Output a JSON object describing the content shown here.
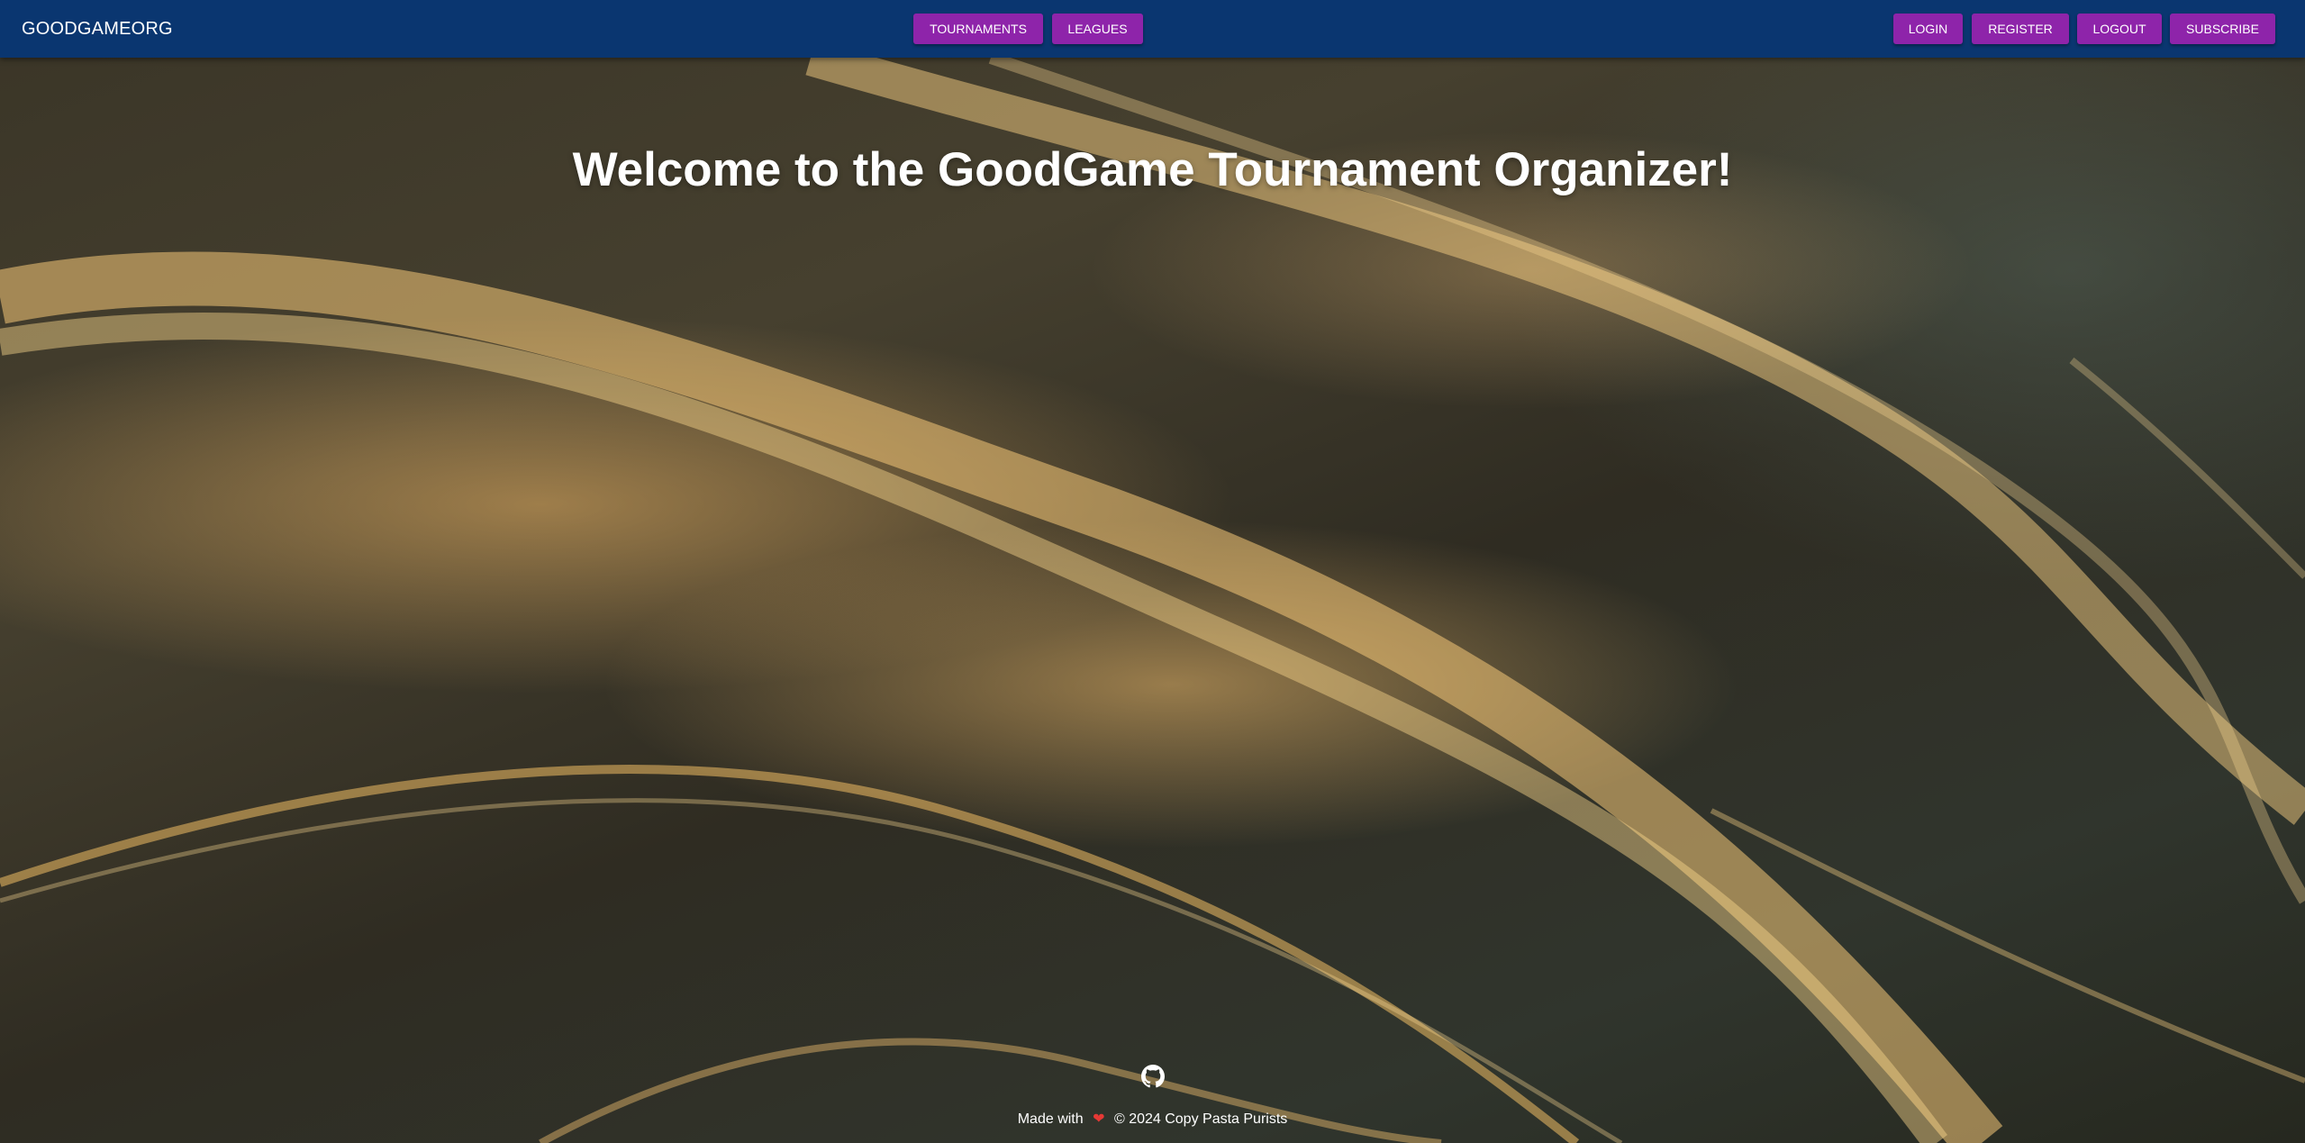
{
  "navbar": {
    "brand": "GOODGAMEORG",
    "center_links": [
      {
        "label": "TOURNAMENTS"
      },
      {
        "label": "LEAGUES"
      }
    ],
    "right_links": [
      {
        "label": "LOGIN"
      },
      {
        "label": "REGISTER"
      },
      {
        "label": "LOGOUT"
      },
      {
        "label": "SUBSCRIBE"
      }
    ]
  },
  "hero": {
    "title": "Welcome to the GoodGame Tournament Organizer!"
  },
  "footer": {
    "github_icon": "github-icon",
    "made_with": "Made with",
    "heart_icon": "heart-icon",
    "copyright": "© 2024 Copy Pasta Purists"
  },
  "colors": {
    "navbar_bg": "#0a3670",
    "button_bg": "#8e24aa",
    "text": "#ffffff",
    "heart": "#e53935"
  }
}
